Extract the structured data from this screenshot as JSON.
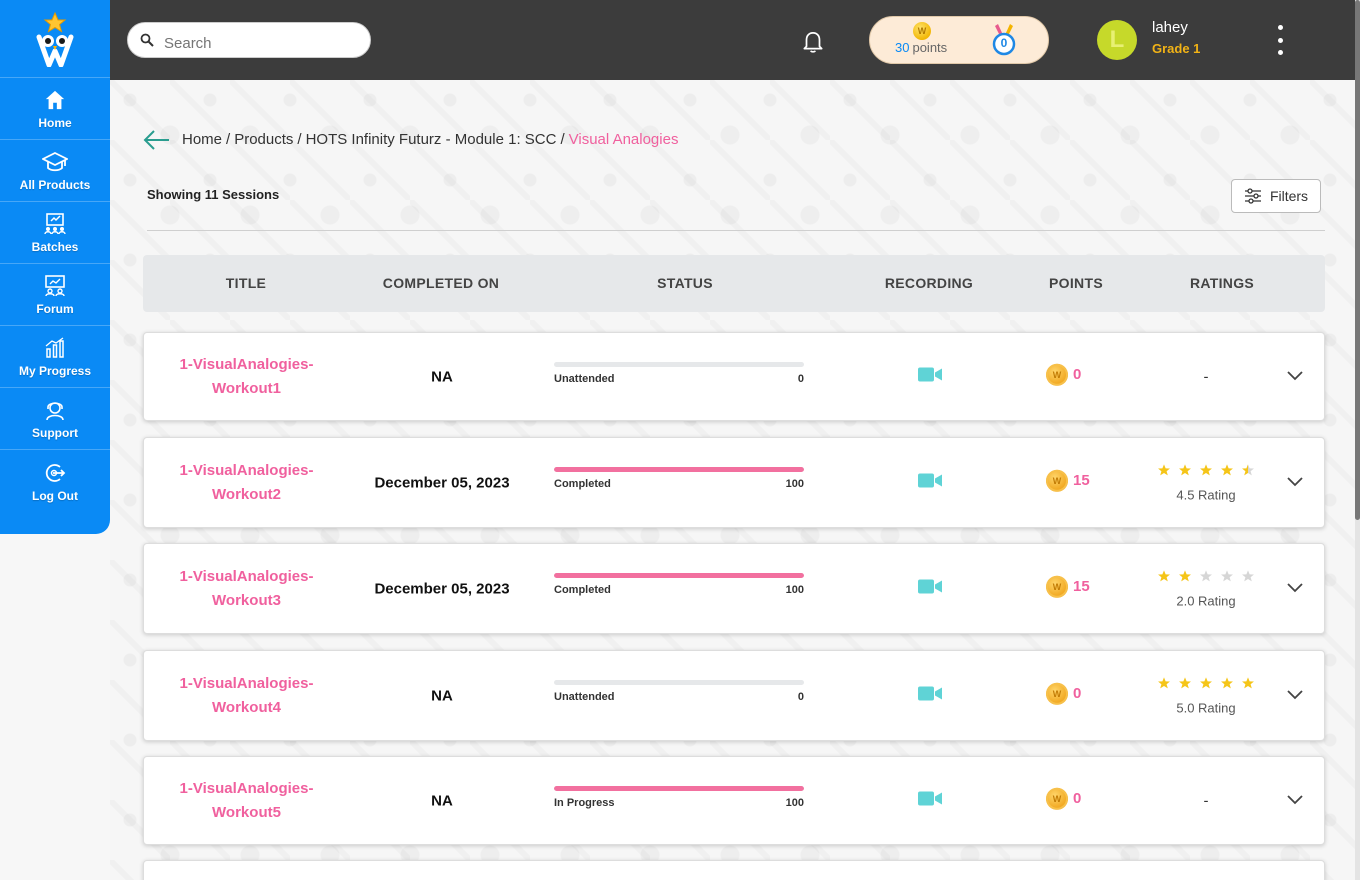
{
  "sidebar": {
    "items": [
      {
        "label": "Home",
        "icon": "home-icon"
      },
      {
        "label": "All Products",
        "icon": "graduation-cap-icon"
      },
      {
        "label": "Batches",
        "icon": "batches-icon"
      },
      {
        "label": "Forum",
        "icon": "forum-icon"
      },
      {
        "label": "My Progress",
        "icon": "bar-chart-icon"
      },
      {
        "label": "Support",
        "icon": "support-icon"
      },
      {
        "label": "Log Out",
        "icon": "logout-icon"
      }
    ]
  },
  "header": {
    "search_placeholder": "Search",
    "points_value": "30",
    "points_label": "points",
    "medal_count": "0",
    "user_initial": "L",
    "user_name": "lahey",
    "user_grade": "Grade 1"
  },
  "breadcrumb": {
    "items": [
      "Home",
      "Products",
      "HOTS Infinity Futurz - Module 1: SCC"
    ],
    "current": "Visual Analogies"
  },
  "showing_text": "Showing 11 Sessions",
  "filters_label": "Filters",
  "table": {
    "headers": [
      "TITLE",
      "COMPLETED ON",
      "STATUS",
      "RECORDING",
      "POINTS",
      "RATINGS"
    ],
    "rows": [
      {
        "title_line1": "1-VisualAnalogies-",
        "title_line2": "Workout1",
        "completed_on": "NA",
        "status": "Unattended",
        "progress": 0,
        "progress_label": "0",
        "points": "0",
        "rating": null,
        "rating_text": "-"
      },
      {
        "title_line1": "1-VisualAnalogies-",
        "title_line2": "Workout2",
        "completed_on": "December 05, 2023",
        "status": "Completed",
        "progress": 100,
        "progress_label": "100",
        "points": "15",
        "rating": 4.5,
        "rating_text": "4.5 Rating"
      },
      {
        "title_line1": "1-VisualAnalogies-",
        "title_line2": "Workout3",
        "completed_on": "December 05, 2023",
        "status": "Completed",
        "progress": 100,
        "progress_label": "100",
        "points": "15",
        "rating": 2.0,
        "rating_text": "2.0 Rating"
      },
      {
        "title_line1": "1-VisualAnalogies-",
        "title_line2": "Workout4",
        "completed_on": "NA",
        "status": "Unattended",
        "progress": 0,
        "progress_label": "0",
        "points": "0",
        "rating": 5.0,
        "rating_text": "5.0 Rating"
      },
      {
        "title_line1": "1-VisualAnalogies-",
        "title_line2": "Workout5",
        "completed_on": "NA",
        "status": "In Progress",
        "progress": 100,
        "progress_label": "100",
        "points": "0",
        "rating": null,
        "rating_text": "-"
      }
    ]
  },
  "colors": {
    "sidebar": "#0a8af5",
    "topbar": "#3c3c3c",
    "accent_pink": "#f0609e",
    "progress_fill": "#f2709f",
    "recording_icon": "#5fd3d6",
    "star_filled": "#f5c518",
    "star_empty": "#d6d6d6",
    "grade": "#f2b316"
  }
}
